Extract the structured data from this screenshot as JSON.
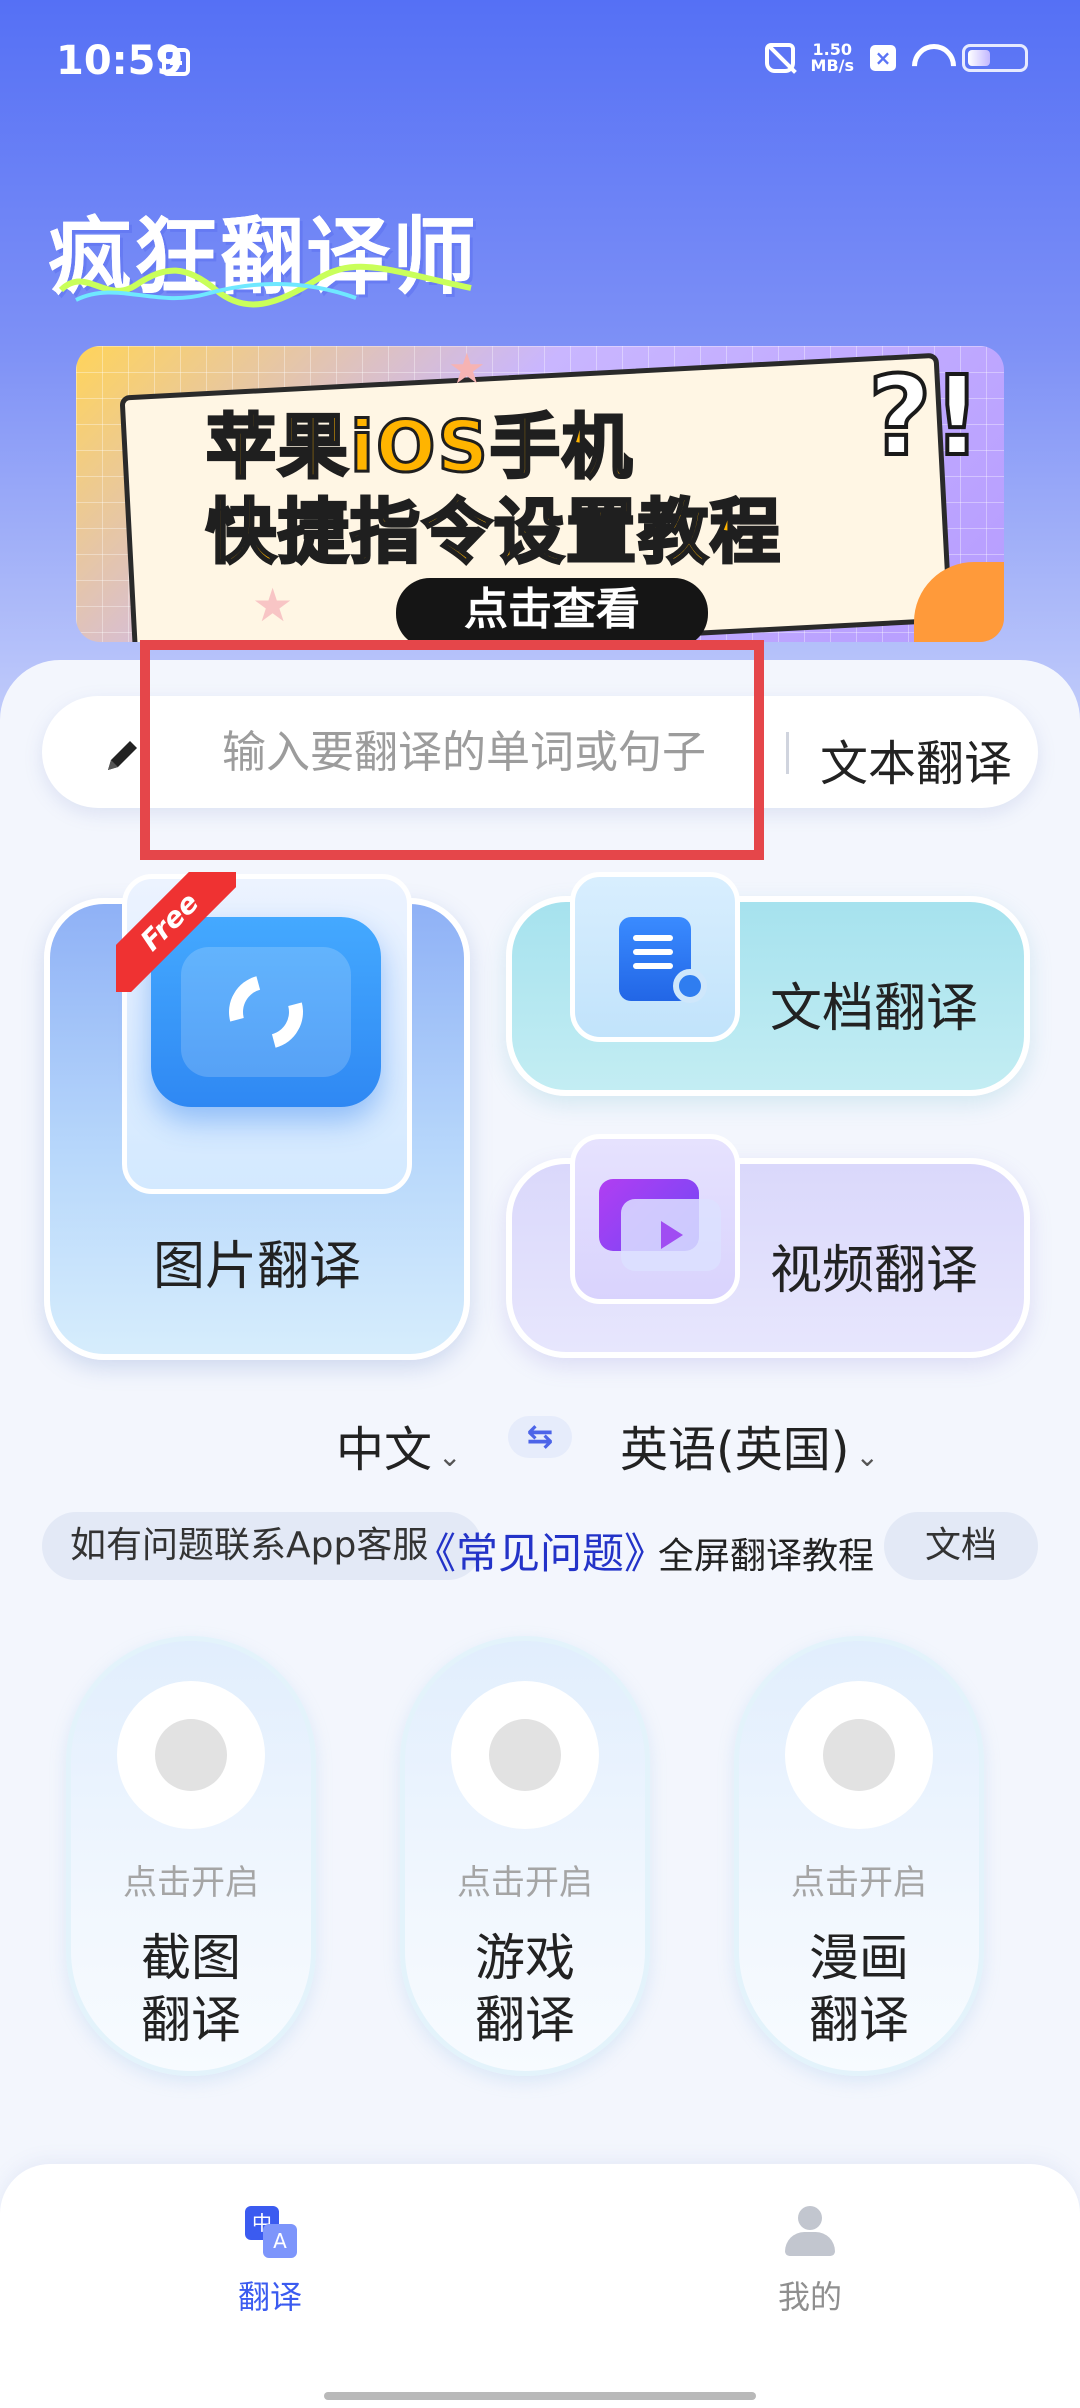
{
  "status_bar": {
    "time": "10:59",
    "net_speed": "1.50\nMB/s",
    "icons": [
      "mute-icon",
      "close-icon",
      "wifi-icon",
      "battery-icon"
    ]
  },
  "brand": {
    "title": "疯狂翻译师"
  },
  "banner": {
    "line1": "苹果iOS手机",
    "line2": "快捷指令设置教程",
    "cta": "点击查看",
    "decor": "?!"
  },
  "text_translate": {
    "placeholder": "输入要翻译的单词或句子",
    "value": "",
    "label": "文本翻译"
  },
  "features": {
    "image": {
      "label": "图片翻译",
      "badge": "Free"
    },
    "document": {
      "label": "文档翻译"
    },
    "video": {
      "label": "视频翻译"
    }
  },
  "language": {
    "source": "中文",
    "swap": "⇆",
    "target": "英语(英国)",
    "chevron": "⌄"
  },
  "info": {
    "contact": "如有问题联系App客服",
    "faq": "《常见问题》",
    "fullscreen_tutorial": "全屏翻译教程",
    "doc": "文档"
  },
  "toggles": [
    {
      "hint": "点击开启",
      "title_line1": "截图",
      "title_line2": "翻译"
    },
    {
      "hint": "点击开启",
      "title_line1": "游戏",
      "title_line2": "翻译"
    },
    {
      "hint": "点击开启",
      "title_line1": "漫画",
      "title_line2": "翻译"
    }
  ],
  "bottom_nav": {
    "items": [
      {
        "label": "翻译",
        "icon": "translate-icon",
        "active": true
      },
      {
        "label": "我的",
        "icon": "user-icon",
        "active": false
      }
    ]
  },
  "colors": {
    "accent": "#3b5bf0",
    "highlight": "#e5464a",
    "faq_link": "#2333c8"
  }
}
